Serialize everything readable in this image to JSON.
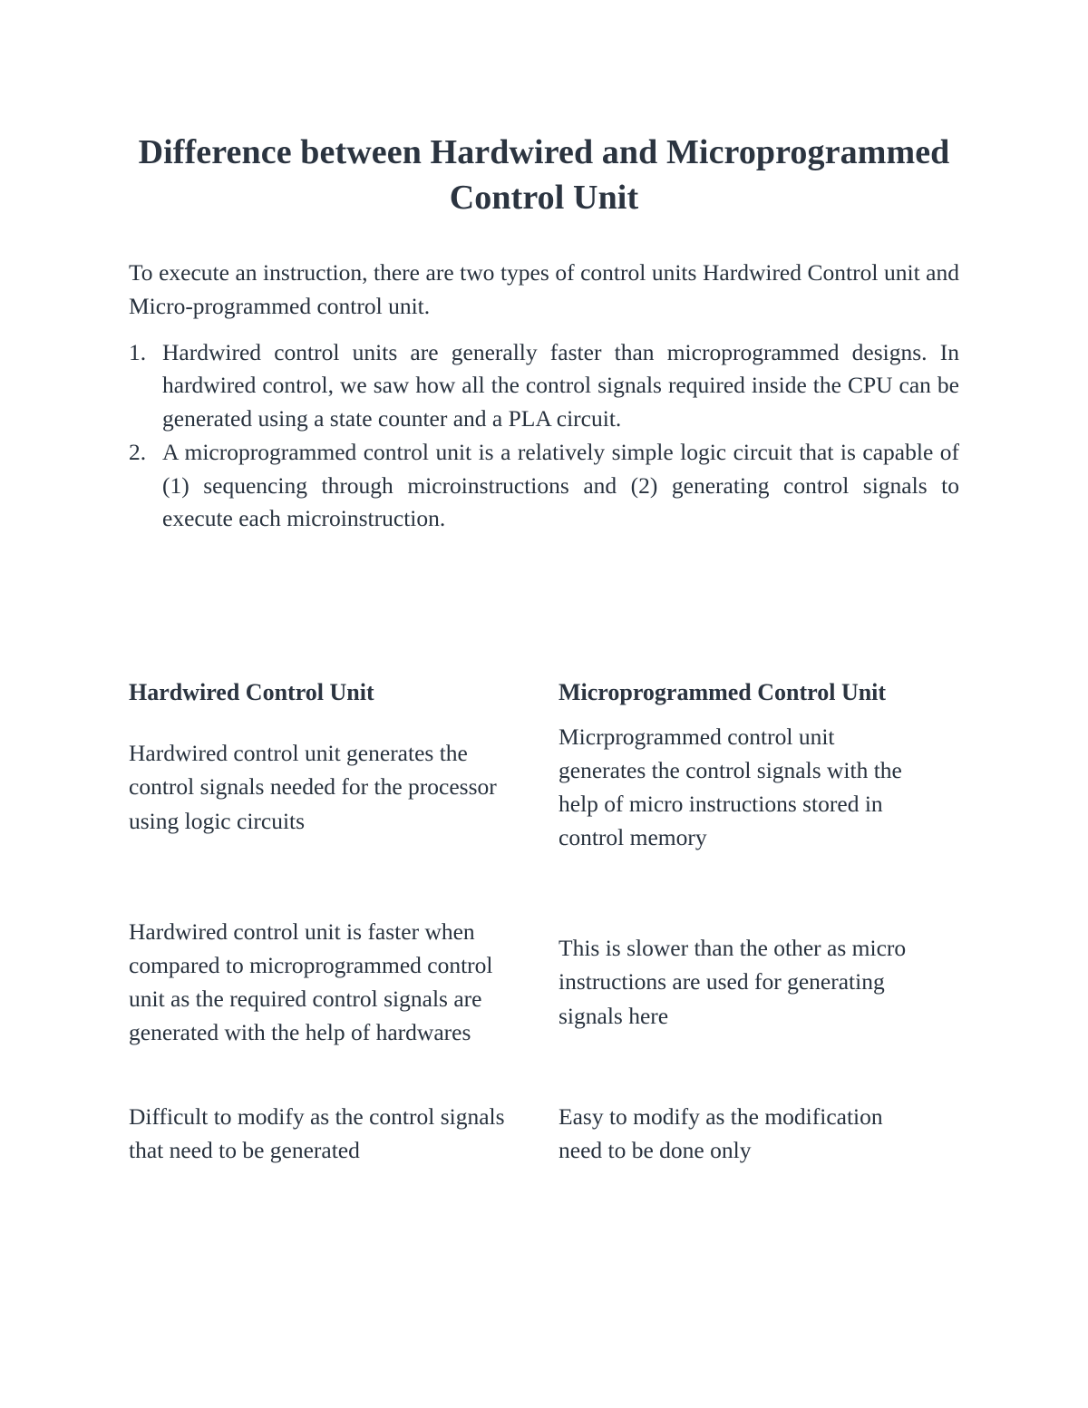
{
  "document": {
    "title": "Difference between Hardwired and Microprogrammed Control Unit",
    "intro": "To execute an instruction, there are two types of control units Hardwired Control unit and Micro-programmed control unit.",
    "list": [
      {
        "marker": "1.",
        "text": "Hardwired control units are generally faster than microprogrammed designs. In hardwired control, we saw how all the control signals required inside the CPU can be generated using a state counter and a PLA circuit."
      },
      {
        "marker": "2.",
        "text": "A microprogrammed control unit is a relatively simple logic circuit that is capable of (1) sequencing through microinstructions and (2) generating control signals to execute each microinstruction."
      }
    ],
    "comparison_table": {
      "headers": [
        "Hardwired Control Unit",
        "Microprogrammed Control Unit"
      ],
      "rows": [
        {
          "hardwired": "Hardwired control unit generates the control signals needed for the processor using logic circuits",
          "microprogrammed": "Micrprogrammed control unit generates the control signals with the help of micro instructions stored in control memory"
        },
        {
          "hardwired": "Hardwired control unit is faster when compared to microprogrammed control unit as the required control signals are generated with the help of hardwares",
          "microprogrammed": "This is slower than the other as micro instructions are used for generating signals here"
        },
        {
          "hardwired": "Difficult to modify as the control signals that need to be generated",
          "microprogrammed": "Easy to modify as the modification need to be done only"
        }
      ]
    }
  },
  "colors": {
    "page_background": "#ffffff",
    "title_text": "#2b3440",
    "body_text": "#28323e"
  }
}
